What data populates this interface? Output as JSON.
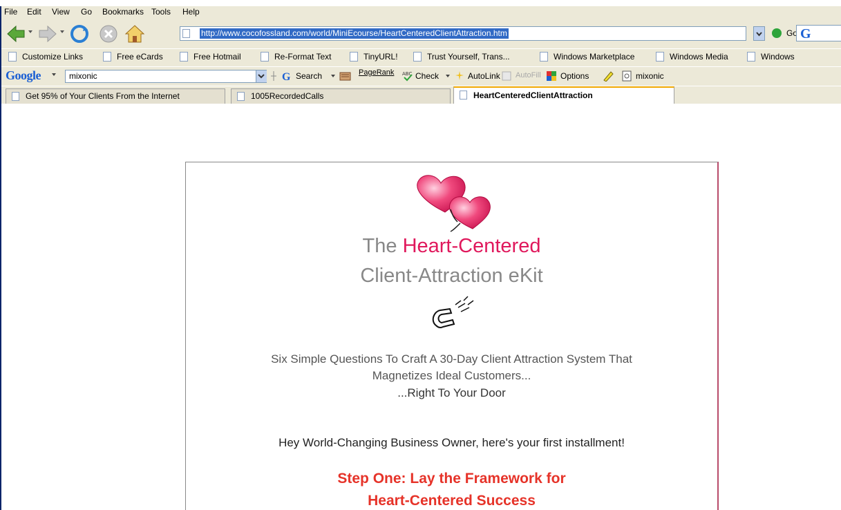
{
  "browser": {
    "menu": [
      "File",
      "Edit",
      "View",
      "Go",
      "Bookmarks",
      "Tools",
      "Help"
    ],
    "url": "http://www.cocofossland.com/world/MiniEcourse/HeartCenteredClientAttraction.htm",
    "go_label": "Go",
    "bookmarks": [
      "Customize Links",
      "Free eCards",
      "Free Hotmail",
      "Re-Format Text",
      "TinyURL!",
      "Trust Yourself, Trans...",
      "Windows Marketplace",
      "Windows Media",
      "Windows"
    ],
    "google_toolbar": {
      "logo": "Google",
      "query": "mixonic",
      "search_label": "Search",
      "pagerank_label": "PageRank",
      "check_label": "Check",
      "autolink_label": "AutoLink",
      "autofill_label": "AutoFill",
      "options_label": "Options",
      "highlight_term": "mixonic"
    },
    "tabs": [
      "Get 95% of Your Clients From the Internet",
      "1005RecordedCalls",
      "HeartCenteredClientAttraction"
    ],
    "active_tab_index": 2
  },
  "page": {
    "title_prefix": "The ",
    "title_highlight": "Heart-Centered",
    "title_line2": "Client-Attraction eKit",
    "subtitle_lines": [
      "Six Simple Questions To Craft A 30-Day Client Attraction System That",
      "Magnetizes Ideal Customers...",
      "...Right To Your Door"
    ],
    "greeting": "Hey World-Changing Business Owner, here's your first installment!",
    "step_lines": [
      "Step One:  Lay the Framework for",
      "Heart-Centered Success"
    ]
  },
  "colors": {
    "accent_pink": "#e0185c",
    "step_red": "#e63329",
    "title_gray": "#888888",
    "chrome_bg": "#ece9d8",
    "selection_blue": "#316ac5"
  }
}
